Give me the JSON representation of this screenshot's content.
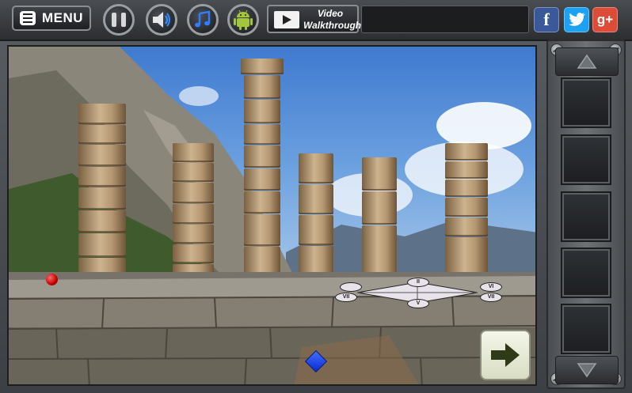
{
  "toolbar": {
    "menu_label": "MENU",
    "video_line1": "Video",
    "video_line2": "Walkthrough",
    "icons": [
      "menu-icon",
      "pause-icon",
      "sound-icon",
      "music-icon",
      "android-icon",
      "video-icon",
      "facebook-icon",
      "twitter-icon",
      "google-plus-icon"
    ]
  },
  "social": {
    "facebook": "f",
    "twitter": "t",
    "google_plus": "g+"
  },
  "scene": {
    "compass_labels": [
      "II",
      "VI",
      "VII",
      "VII",
      "V"
    ],
    "items": [
      "red-ball",
      "blue-gem"
    ]
  },
  "inventory": {
    "slot_count": 5
  },
  "colors": {
    "facebook": "#3b5998",
    "twitter": "#1da1f2",
    "google_plus": "#dd4b39",
    "android": "#a4c639",
    "accent": "#2f3a18"
  }
}
